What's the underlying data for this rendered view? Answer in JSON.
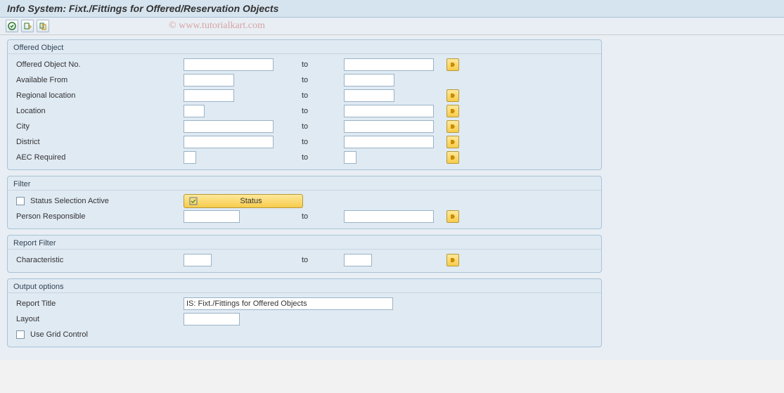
{
  "title": "Info System: Fixt./Fittings for Offered/Reservation Objects",
  "watermark": "© www.tutorialkart.com",
  "labels": {
    "to": "to"
  },
  "groups": {
    "offered": {
      "title": "Offered Object",
      "rows": {
        "object_no": {
          "label": "Offered Object No.",
          "from": "",
          "to": "",
          "multi": true,
          "from_w": 128,
          "to_w": 128
        },
        "available_from": {
          "label": "Available From",
          "from": "",
          "to": "",
          "multi": false,
          "from_w": 72,
          "to_w": 72
        },
        "regional_location": {
          "label": "Regional location",
          "from": "",
          "to": "",
          "multi": true,
          "from_w": 72,
          "to_w": 72
        },
        "location": {
          "label": "Location",
          "from": "",
          "to": "",
          "multi": true,
          "from_w": 30,
          "to_w": 128
        },
        "city": {
          "label": "City",
          "from": "",
          "to": "",
          "multi": true,
          "from_w": 128,
          "to_w": 128
        },
        "district": {
          "label": "District",
          "from": "",
          "to": "",
          "multi": true,
          "from_w": 128,
          "to_w": 128
        },
        "aec_required": {
          "label": "AEC Required",
          "from": "",
          "to": "",
          "multi": true,
          "from_w": 18,
          "to_w": 18
        }
      }
    },
    "filter": {
      "title": "Filter",
      "status_selection_active_label": "Status Selection Active",
      "status_selection_active_checked": false,
      "status_button_label": "Status",
      "person_responsible": {
        "label": "Person Responsible",
        "from": "",
        "to": "",
        "multi": true,
        "from_w": 80,
        "to_w": 128
      }
    },
    "report_filter": {
      "title": "Report Filter",
      "characteristic": {
        "label": "Characteristic",
        "from": "",
        "to": "",
        "multi": true,
        "from_w": 40,
        "to_w": 40
      }
    },
    "output": {
      "title": "Output options",
      "report_title_label": "Report Title",
      "report_title_value": "IS: Fixt./Fittings for Offered Objects",
      "layout_label": "Layout",
      "layout_value": "",
      "use_grid_label": "Use Grid Control",
      "use_grid_checked": false
    }
  }
}
